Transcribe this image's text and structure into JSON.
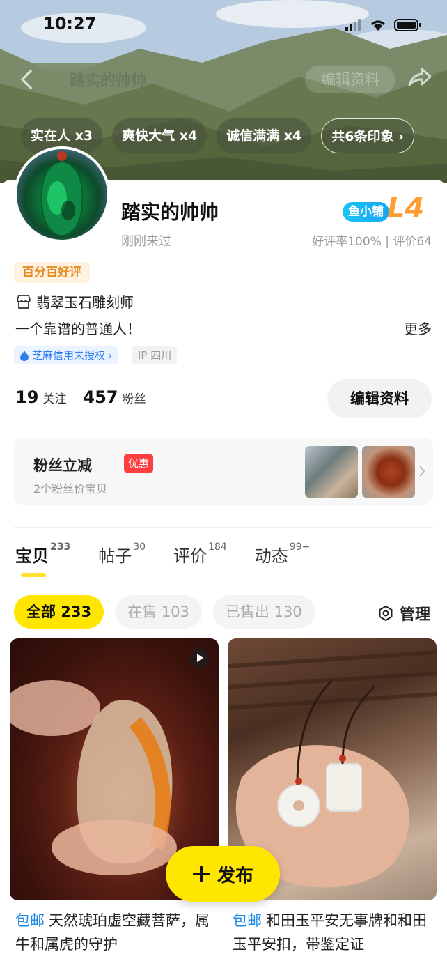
{
  "status_bar": {
    "time": "10:27"
  },
  "nav": {
    "title": "踏实的帅帅",
    "edit_label": "编辑资料"
  },
  "impression_tags": [
    {
      "label": "实在人 x3"
    },
    {
      "label": "爽快大气 x4"
    },
    {
      "label": "诚信满满 x4"
    },
    {
      "label": "共6条印象 ›"
    }
  ],
  "profile": {
    "name": "踏实的帅帅",
    "last_visit": "刚刚来过",
    "shop_badge": "鱼小铺",
    "level": "L4",
    "rating": "好评率100% | 评价64",
    "good_tag": "百分百好评",
    "occupation": "翡翠玉石雕刻师",
    "bio": "一个靠谱的普通人！",
    "more_label": "更多",
    "zhima": "芝麻信用未授权",
    "ip": "IP 四川"
  },
  "stats": {
    "following": "19",
    "following_label": "关注",
    "followers": "457",
    "followers_label": "粉丝",
    "edit_label": "编辑资料"
  },
  "promo": {
    "title": "粉丝立减",
    "badge": "优惠",
    "subtitle": "2个粉丝价宝贝"
  },
  "tabs": [
    {
      "label": "宝贝",
      "count": "233"
    },
    {
      "label": "帖子",
      "count": "30"
    },
    {
      "label": "评价",
      "count": "184"
    },
    {
      "label": "动态",
      "count": "99+"
    }
  ],
  "filters": [
    {
      "label": "全部 233"
    },
    {
      "label": "在售 103"
    },
    {
      "label": "已售出 130"
    }
  ],
  "manage_label": "管理",
  "products": [
    {
      "free_shipping": "包邮",
      "title": "天然琥珀虚空藏菩萨，属牛和属虎的守护"
    },
    {
      "free_shipping": "包邮",
      "title": "和田玉平安无事牌和和田玉平安扣，带鉴定证"
    }
  ],
  "fab_label": "发布",
  "colors": {
    "accent": "#ffe600",
    "link_blue": "#1d8ae8",
    "level_orange": "#ff9d2e",
    "promo_red": "#ff3f3f"
  }
}
